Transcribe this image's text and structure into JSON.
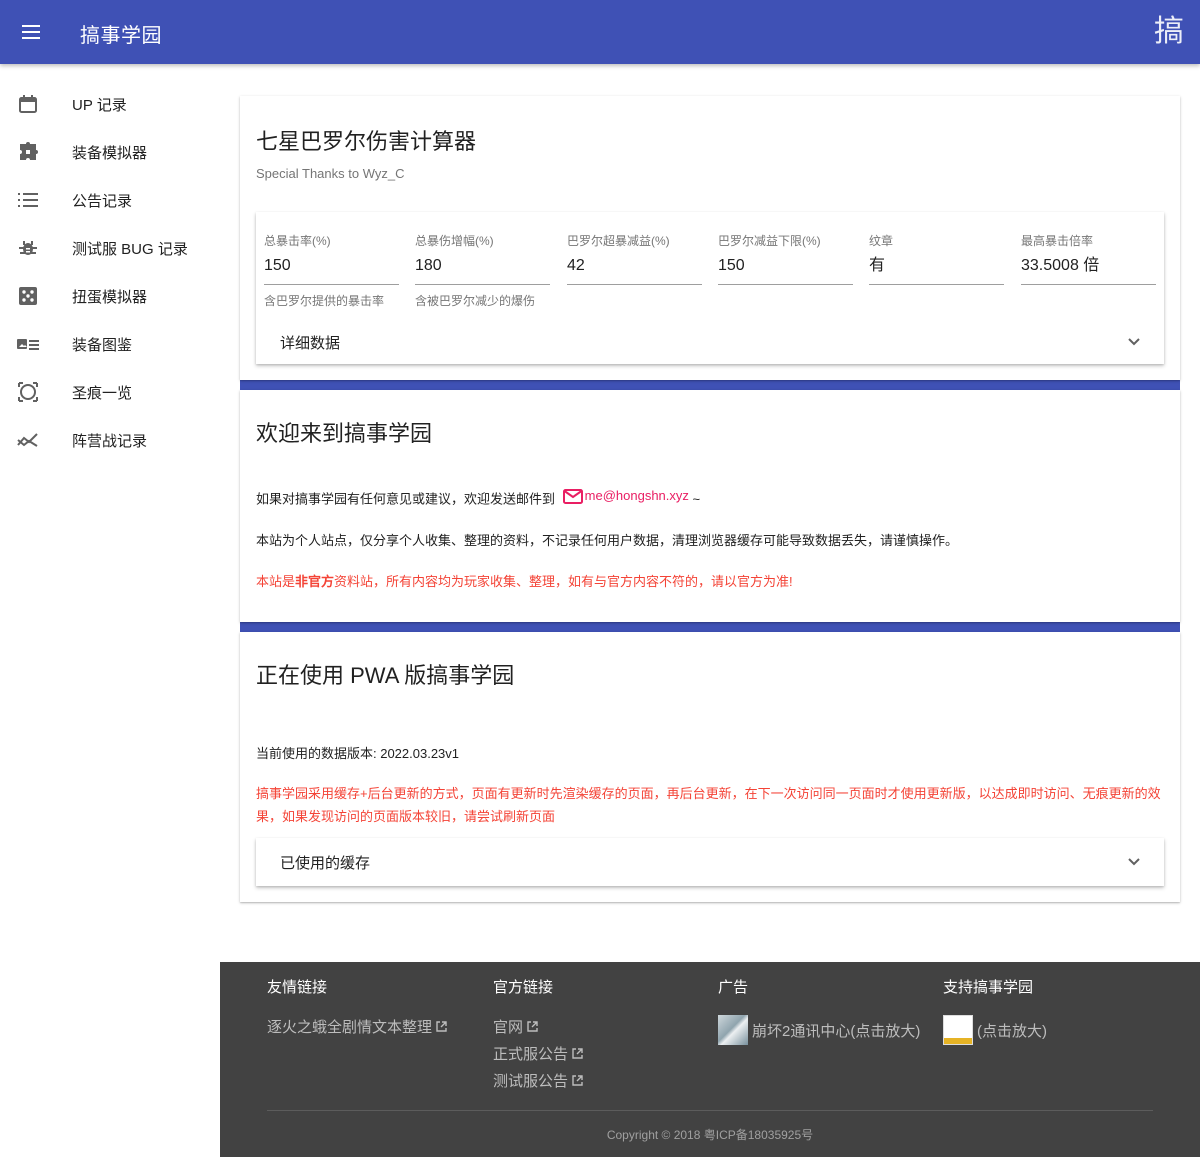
{
  "appbar": {
    "title": "搞事学园",
    "logo_glyph": "搞",
    "menu_icon": "menu-icon",
    "color": "#3f51b5"
  },
  "sidebar": {
    "items": [
      {
        "label": "UP 记录",
        "icon": "calendar-icon"
      },
      {
        "label": "装备模拟器",
        "icon": "puzzle-icon"
      },
      {
        "label": "公告记录",
        "icon": "list-icon"
      },
      {
        "label": "测试服 BUG 记录",
        "icon": "bug-icon"
      },
      {
        "label": "扭蛋模拟器",
        "icon": "dice-icon"
      },
      {
        "label": "装备图鉴",
        "icon": "card-icon"
      },
      {
        "label": "圣痕一览",
        "icon": "crop-icon"
      },
      {
        "label": "阵营战记录",
        "icon": "chart-icon"
      }
    ]
  },
  "calculator": {
    "title": "七星巴罗尔伤害计算器",
    "subtitle": "Special Thanks to Wyz_C",
    "fields": [
      {
        "label": "总暴击率(%)",
        "value": "150",
        "hint": "含巴罗尔提供的暴击率"
      },
      {
        "label": "总暴伤增幅(%)",
        "value": "180",
        "hint": "含被巴罗尔减少的爆伤"
      },
      {
        "label": "巴罗尔超暴减益(%)",
        "value": "42",
        "hint": ""
      },
      {
        "label": "巴罗尔减益下限(%)",
        "value": "150",
        "hint": ""
      },
      {
        "label": "纹章",
        "value": "有",
        "hint": ""
      },
      {
        "label": "最高暴击倍率",
        "value": "33.5008 倍",
        "hint": ""
      }
    ],
    "details_label": "详细数据"
  },
  "welcome": {
    "title": "欢迎来到搞事学园",
    "line1_prefix": "如果对搞事学园有任何意见或建议，欢迎发送邮件到",
    "email": "me@hongshn.xyz",
    "line1_suffix": "~",
    "line2": "本站为个人站点，仅分享个人收集、整理的资料，不记录任何用户数据，清理浏览器缓存可能导致数据丢失，请谨慎操作。",
    "line3_prefix": "本站是",
    "line3_bold": "非官方",
    "line3_suffix": "资料站，所有内容均为玩家收集、整理，如有与官方内容不符的，请以官方为准!",
    "warn_color": "#f44336"
  },
  "pwa": {
    "title": "正在使用 PWA 版搞事学园",
    "version_line": "当前使用的数据版本: 2022.03.23v1",
    "notice": "搞事学园采用缓存+后台更新的方式，页面有更新时先渲染缓存的页面，再后台更新，在下一次访问同一页面时才使用更新版，以达成即时访问、无痕更新的效果，如果发现访问的页面版本较旧，请尝试刷新页面",
    "cache_label": "已使用的缓存"
  },
  "footer": {
    "friends": {
      "title": "友情链接",
      "links": [
        "逐火之蛾全剧情文本整理"
      ]
    },
    "official": {
      "title": "官方链接",
      "links": [
        "官网",
        "正式服公告",
        "测试服公告"
      ]
    },
    "ads": {
      "title": "广告",
      "text": "崩坏2通讯中心(点击放大)"
    },
    "support": {
      "title": "支持搞事学园",
      "text": "(点击放大)"
    },
    "copyright": "Copyright © 2018 粤ICP备18035925号"
  }
}
